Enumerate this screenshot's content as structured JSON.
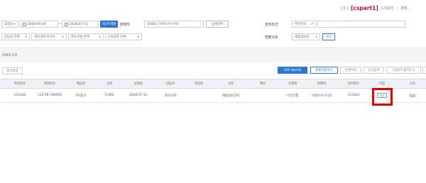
{
  "header": {
    "bracket_text": "[ 0 ]",
    "brand": "[cspart1]",
    "menu1": "C/S관리",
    "menu2": "판매..."
  },
  "filters": {
    "date_type": "요청일",
    "start_date": "2026-04-14",
    "end_date": "2026-07-13",
    "recent_btn": "최근6개월",
    "seller_label": "판매처",
    "seller_value": "10082 74테스트(수정)",
    "detail_btn": "상세선택",
    "manager": "담당자 전체",
    "status": "처리상태 미처리",
    "cancel_type": "취소유형 전체",
    "cs_status": "C/S상태 전체",
    "search_label": "검색조건",
    "search_type": "주문번호",
    "search_value": "",
    "refund_label": "환불사유",
    "refund_type": "제품정보상",
    "refund_btn": "관리"
  },
  "section": {
    "title": "미처리 1건"
  },
  "toolbar": {
    "print": "항목설정",
    "erp_btn": "ERP 계좌이체",
    "refund_process": "환불일괄처리",
    "change_history": "변경이력",
    "apply": "신규등록",
    "download": "다운로드항목1"
  },
  "table": {
    "headers": [
      "주문번호",
      "계좌번호",
      "예금주",
      "금액",
      "요청일",
      "담당자",
      "처리일",
      "사유",
      "메모",
      "은행명",
      "판매처",
      "관리번호",
      "작업",
      "C/S"
    ],
    "rows": [
      {
        "order_no": "115344",
        "account": "123-56-789456",
        "holder": "(주)팀즈",
        "amount": "5,000",
        "request_date": "2026-07-13",
        "manager": "관리자74",
        "process_date": "",
        "reason": "제품정보상이",
        "memo": "",
        "bank": "국민은행",
        "seller": "74테스트(수정)",
        "manage_no": "115344",
        "action": "수정",
        "cs": ""
      }
    ]
  }
}
